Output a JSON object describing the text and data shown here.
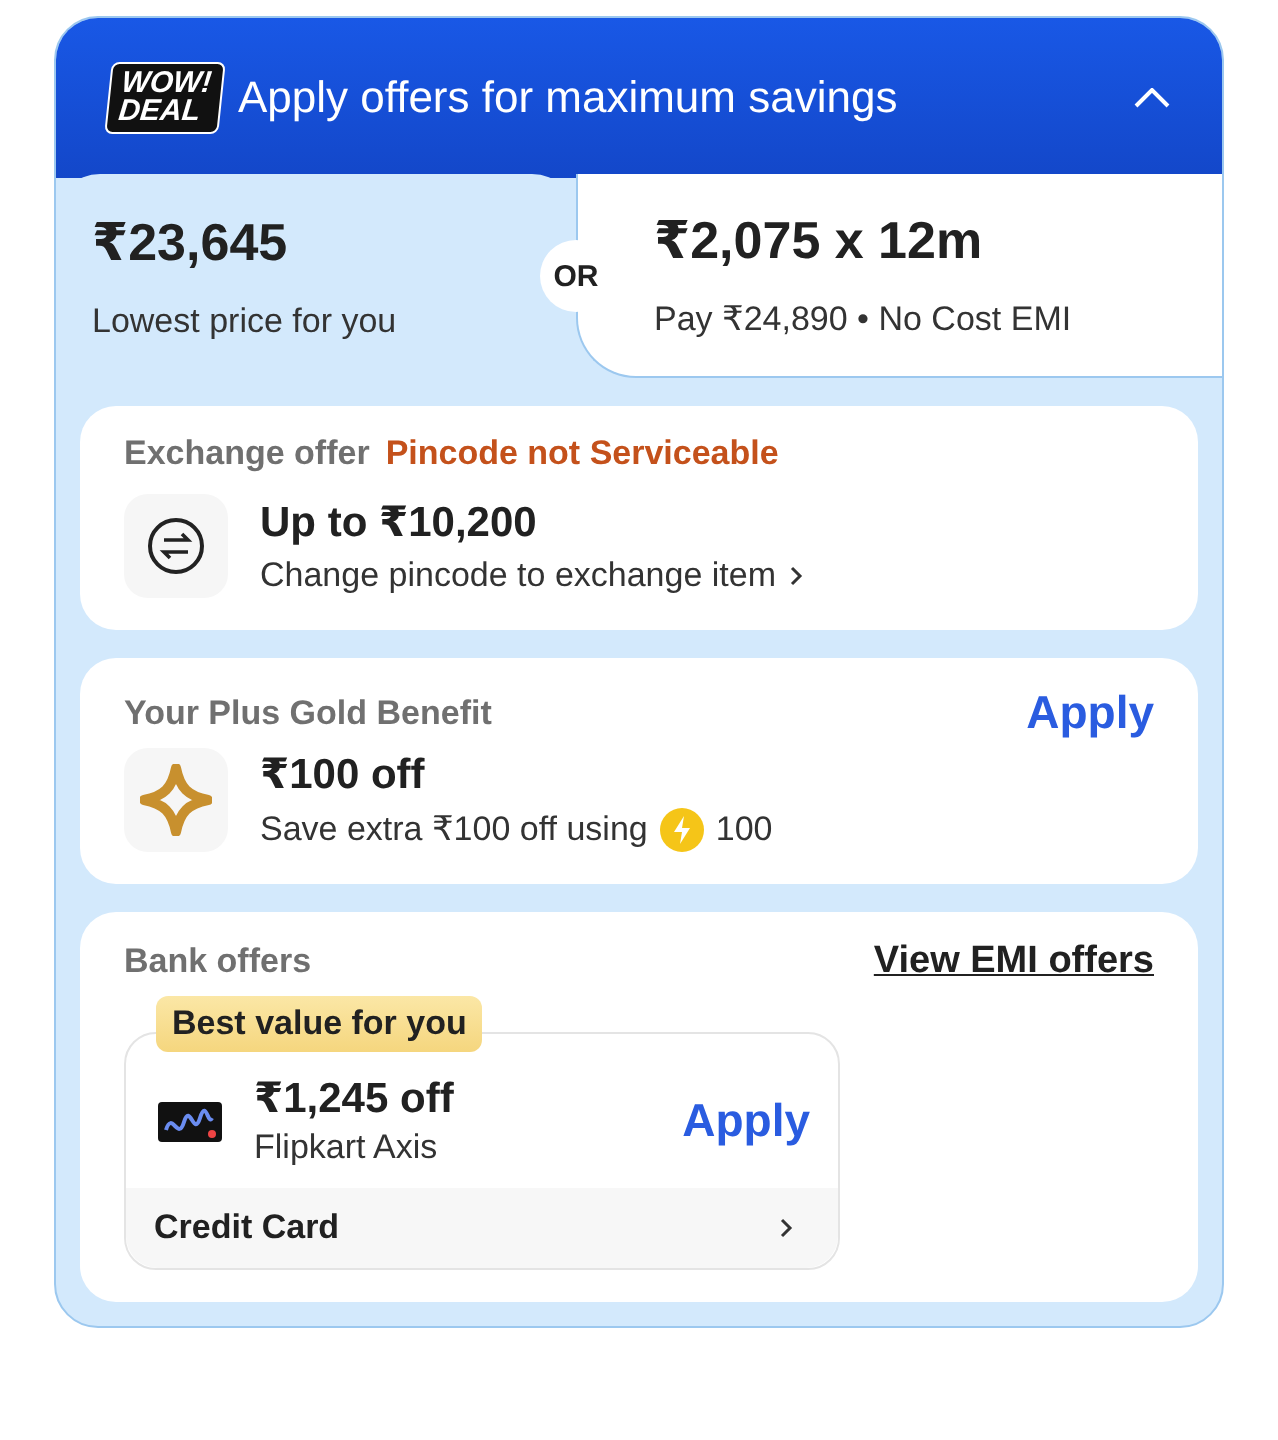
{
  "header": {
    "badge": "WOW!\nDEAL",
    "title": "Apply offers for maximum savings",
    "expanded": true
  },
  "price_options": [
    {
      "price": "₹23,645",
      "caption": "Lowest price for you",
      "selected": true
    },
    {
      "price": "₹2,075 x 12m",
      "caption": "Pay ₹24,890 • No Cost EMI",
      "selected": false
    }
  ],
  "separator": "OR",
  "offers": [
    {
      "kind": "exchange",
      "heading": "Exchange offer",
      "status": "Pincode not Serviceable",
      "amount": "Up to ₹10,200",
      "note": "Change pincode to exchange item"
    },
    {
      "kind": "gold",
      "heading": "Your Plus Gold Benefit",
      "action": "Apply",
      "amount": "₹100 off",
      "note": "Save extra ₹100 off using",
      "coins": "100"
    },
    {
      "kind": "bank",
      "heading": "Bank offers",
      "link": "View EMI offers",
      "tag": "Best value for you",
      "amount": "₹1,245 off",
      "bank": "Flipkart Axis",
      "action": "Apply",
      "card_type": "Credit Card"
    }
  ]
}
